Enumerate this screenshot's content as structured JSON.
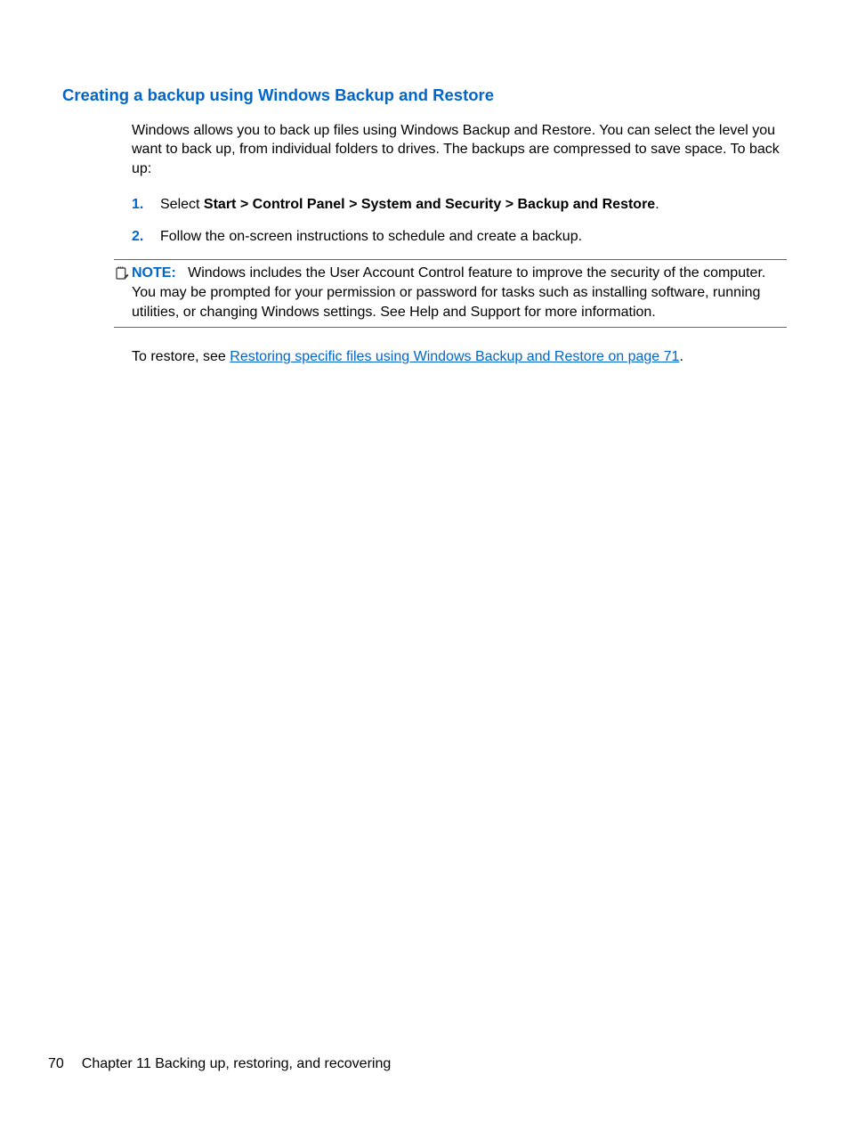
{
  "heading": "Creating a backup using Windows Backup and Restore",
  "intro": "Windows allows you to back up files using Windows Backup and Restore. You can select the level you want to back up, from individual folders to drives. The backups are compressed to save space. To back up:",
  "steps": [
    {
      "num": "1.",
      "prefix": "Select ",
      "bold": "Start > Control Panel > System and Security > Backup and Restore",
      "suffix": "."
    },
    {
      "num": "2.",
      "prefix": "Follow the on-screen instructions to schedule and create a backup.",
      "bold": "",
      "suffix": ""
    }
  ],
  "note": {
    "label": "NOTE:",
    "text": "Windows includes the User Account Control feature to improve the security of the computer. You may be prompted for your permission or password for tasks such as installing software, running utilities, or changing Windows settings. See Help and Support for more information."
  },
  "restore": {
    "prefix": "To restore, see ",
    "link": "Restoring specific files using Windows Backup and Restore on page 71",
    "suffix": "."
  },
  "footer": {
    "page": "70",
    "chapter": "Chapter 11   Backing up, restoring, and recovering"
  }
}
